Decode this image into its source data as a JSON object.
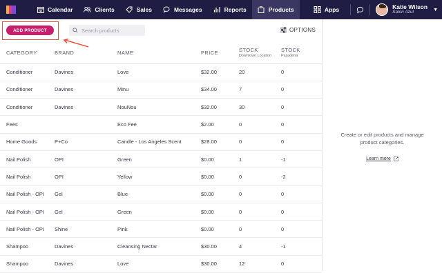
{
  "nav": {
    "items": [
      {
        "label": "Calendar",
        "icon": "calendar-icon"
      },
      {
        "label": "Clients",
        "icon": "clients-icon"
      },
      {
        "label": "Sales",
        "icon": "tag-icon"
      },
      {
        "label": "Messages",
        "icon": "chat-icon"
      },
      {
        "label": "Reports",
        "icon": "bar-chart-icon"
      },
      {
        "label": "Products",
        "icon": "box-icon"
      }
    ],
    "active": "Products",
    "apps_label": "Apps"
  },
  "user": {
    "name": "Katie Wilson",
    "salon": "Salon Azul"
  },
  "toolbar": {
    "add_label": "ADD PRODUCT",
    "search_placeholder": "Search products",
    "options_label": "OPTIONS"
  },
  "table": {
    "headers": {
      "category": "CATEGORY",
      "brand": "BRAND",
      "name": "NAME",
      "price": "PRICE",
      "stock1": "STOCK",
      "stock1_sub": "Downtown Location",
      "stock2": "STOCK",
      "stock2_sub": "Pasadena"
    },
    "rows": [
      [
        "Conditioner",
        "Davines",
        "Love",
        "$32.00",
        "20",
        "0"
      ],
      [
        "Conditioner",
        "Davines",
        "Minu",
        "$34.00",
        "7",
        "0"
      ],
      [
        "Conditioner",
        "Davines",
        "NouNou",
        "$32.00",
        "30",
        "0"
      ],
      [
        "Fees",
        "",
        "Eco Fee",
        "$2.00",
        "0",
        "0"
      ],
      [
        "Home Goods",
        "P+Co",
        "Candle - Los Angeles Scent",
        "$28.00",
        "0",
        "0"
      ],
      [
        "Nail Polish",
        "OPI",
        "Green",
        "$0.00",
        "1",
        "-1"
      ],
      [
        "Nail Polish",
        "OPI",
        "Yellow",
        "$0.00",
        "0",
        "-2"
      ],
      [
        "Nail Polish - OPI",
        "Gel",
        "Blue",
        "$0.00",
        "0",
        "0"
      ],
      [
        "Nail Polish - OPI",
        "Gel",
        "Green",
        "$0.00",
        "0",
        "0"
      ],
      [
        "Nail Polish - OPI",
        "Shine",
        "Pink",
        "$0.00",
        "0",
        "0"
      ],
      [
        "Shampoo",
        "Davines",
        "Cleansing Nectar",
        "$30.00",
        "4",
        "-1"
      ],
      [
        "Shampoo",
        "Davines",
        "Love",
        "$30.00",
        "12",
        "0"
      ]
    ]
  },
  "panel": {
    "text": "Create or edit products and manage product categories.",
    "learn_more": "Learn more"
  },
  "colors": {
    "topbar": "#1f1d43",
    "accent": "#c81f6d",
    "callout": "#e8533a"
  }
}
